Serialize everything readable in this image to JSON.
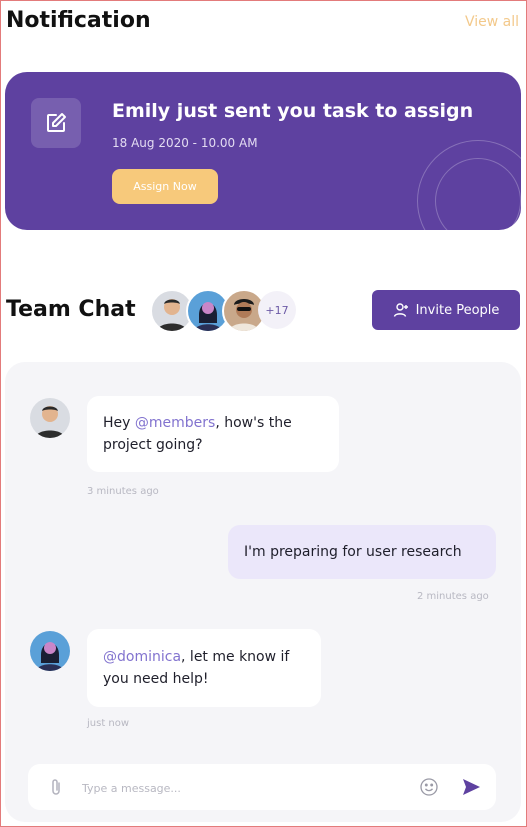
{
  "notification": {
    "title": "Notification",
    "view_all": "View all",
    "card": {
      "message": "Emily just sent you task to assign",
      "date": "18 Aug 2020 - 10.00 AM",
      "button": "Assign Now",
      "icon": "edit-icon"
    }
  },
  "team_chat": {
    "title": "Team Chat",
    "more_members": "+17",
    "invite_button": "Invite People",
    "invite_icon": "user-plus-icon"
  },
  "messages": [
    {
      "direction": "incoming",
      "parts": [
        {
          "text": "Hey ",
          "mention": false
        },
        {
          "text": "@members",
          "mention": true
        },
        {
          "text": ", how's the project going?",
          "mention": false
        }
      ],
      "time": "3 minutes ago"
    },
    {
      "direction": "outgoing",
      "parts": [
        {
          "text": "I'm preparing for user research",
          "mention": false
        }
      ],
      "time": "2 minutes ago"
    },
    {
      "direction": "incoming",
      "parts": [
        {
          "text": "@dominica",
          "mention": true
        },
        {
          "text": ", let me know if you need help!",
          "mention": false
        }
      ],
      "time": "just now"
    }
  ],
  "composer": {
    "placeholder": "Type a message...",
    "attach_icon": "paperclip-icon",
    "emoji_icon": "smiley-icon",
    "send_icon": "send-icon"
  },
  "colors": {
    "primary": "#5e41a0",
    "accent": "#f7c97b",
    "mention": "#8273cf",
    "chat_bg": "#f5f5f8",
    "outgoing_bubble": "#ebe7fa"
  }
}
